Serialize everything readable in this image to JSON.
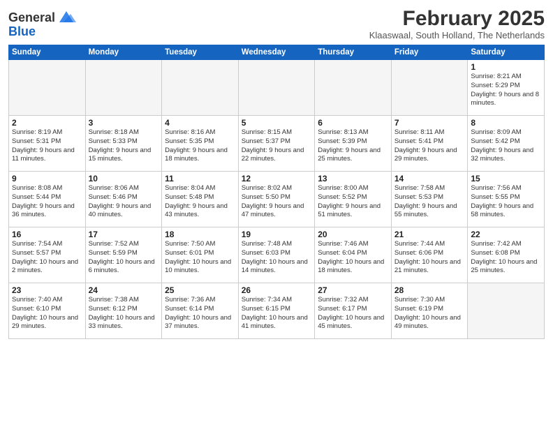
{
  "header": {
    "logo_general": "General",
    "logo_blue": "Blue",
    "month_year": "February 2025",
    "location": "Klaaswaal, South Holland, The Netherlands"
  },
  "days_of_week": [
    "Sunday",
    "Monday",
    "Tuesday",
    "Wednesday",
    "Thursday",
    "Friday",
    "Saturday"
  ],
  "weeks": [
    [
      {
        "day": "",
        "info": ""
      },
      {
        "day": "",
        "info": ""
      },
      {
        "day": "",
        "info": ""
      },
      {
        "day": "",
        "info": ""
      },
      {
        "day": "",
        "info": ""
      },
      {
        "day": "",
        "info": ""
      },
      {
        "day": "1",
        "info": "Sunrise: 8:21 AM\nSunset: 5:29 PM\nDaylight: 9 hours and 8 minutes."
      }
    ],
    [
      {
        "day": "2",
        "info": "Sunrise: 8:19 AM\nSunset: 5:31 PM\nDaylight: 9 hours and 11 minutes."
      },
      {
        "day": "3",
        "info": "Sunrise: 8:18 AM\nSunset: 5:33 PM\nDaylight: 9 hours and 15 minutes."
      },
      {
        "day": "4",
        "info": "Sunrise: 8:16 AM\nSunset: 5:35 PM\nDaylight: 9 hours and 18 minutes."
      },
      {
        "day": "5",
        "info": "Sunrise: 8:15 AM\nSunset: 5:37 PM\nDaylight: 9 hours and 22 minutes."
      },
      {
        "day": "6",
        "info": "Sunrise: 8:13 AM\nSunset: 5:39 PM\nDaylight: 9 hours and 25 minutes."
      },
      {
        "day": "7",
        "info": "Sunrise: 8:11 AM\nSunset: 5:41 PM\nDaylight: 9 hours and 29 minutes."
      },
      {
        "day": "8",
        "info": "Sunrise: 8:09 AM\nSunset: 5:42 PM\nDaylight: 9 hours and 32 minutes."
      }
    ],
    [
      {
        "day": "9",
        "info": "Sunrise: 8:08 AM\nSunset: 5:44 PM\nDaylight: 9 hours and 36 minutes."
      },
      {
        "day": "10",
        "info": "Sunrise: 8:06 AM\nSunset: 5:46 PM\nDaylight: 9 hours and 40 minutes."
      },
      {
        "day": "11",
        "info": "Sunrise: 8:04 AM\nSunset: 5:48 PM\nDaylight: 9 hours and 43 minutes."
      },
      {
        "day": "12",
        "info": "Sunrise: 8:02 AM\nSunset: 5:50 PM\nDaylight: 9 hours and 47 minutes."
      },
      {
        "day": "13",
        "info": "Sunrise: 8:00 AM\nSunset: 5:52 PM\nDaylight: 9 hours and 51 minutes."
      },
      {
        "day": "14",
        "info": "Sunrise: 7:58 AM\nSunset: 5:53 PM\nDaylight: 9 hours and 55 minutes."
      },
      {
        "day": "15",
        "info": "Sunrise: 7:56 AM\nSunset: 5:55 PM\nDaylight: 9 hours and 58 minutes."
      }
    ],
    [
      {
        "day": "16",
        "info": "Sunrise: 7:54 AM\nSunset: 5:57 PM\nDaylight: 10 hours and 2 minutes."
      },
      {
        "day": "17",
        "info": "Sunrise: 7:52 AM\nSunset: 5:59 PM\nDaylight: 10 hours and 6 minutes."
      },
      {
        "day": "18",
        "info": "Sunrise: 7:50 AM\nSunset: 6:01 PM\nDaylight: 10 hours and 10 minutes."
      },
      {
        "day": "19",
        "info": "Sunrise: 7:48 AM\nSunset: 6:03 PM\nDaylight: 10 hours and 14 minutes."
      },
      {
        "day": "20",
        "info": "Sunrise: 7:46 AM\nSunset: 6:04 PM\nDaylight: 10 hours and 18 minutes."
      },
      {
        "day": "21",
        "info": "Sunrise: 7:44 AM\nSunset: 6:06 PM\nDaylight: 10 hours and 21 minutes."
      },
      {
        "day": "22",
        "info": "Sunrise: 7:42 AM\nSunset: 6:08 PM\nDaylight: 10 hours and 25 minutes."
      }
    ],
    [
      {
        "day": "23",
        "info": "Sunrise: 7:40 AM\nSunset: 6:10 PM\nDaylight: 10 hours and 29 minutes."
      },
      {
        "day": "24",
        "info": "Sunrise: 7:38 AM\nSunset: 6:12 PM\nDaylight: 10 hours and 33 minutes."
      },
      {
        "day": "25",
        "info": "Sunrise: 7:36 AM\nSunset: 6:14 PM\nDaylight: 10 hours and 37 minutes."
      },
      {
        "day": "26",
        "info": "Sunrise: 7:34 AM\nSunset: 6:15 PM\nDaylight: 10 hours and 41 minutes."
      },
      {
        "day": "27",
        "info": "Sunrise: 7:32 AM\nSunset: 6:17 PM\nDaylight: 10 hours and 45 minutes."
      },
      {
        "day": "28",
        "info": "Sunrise: 7:30 AM\nSunset: 6:19 PM\nDaylight: 10 hours and 49 minutes."
      },
      {
        "day": "",
        "info": ""
      }
    ]
  ]
}
